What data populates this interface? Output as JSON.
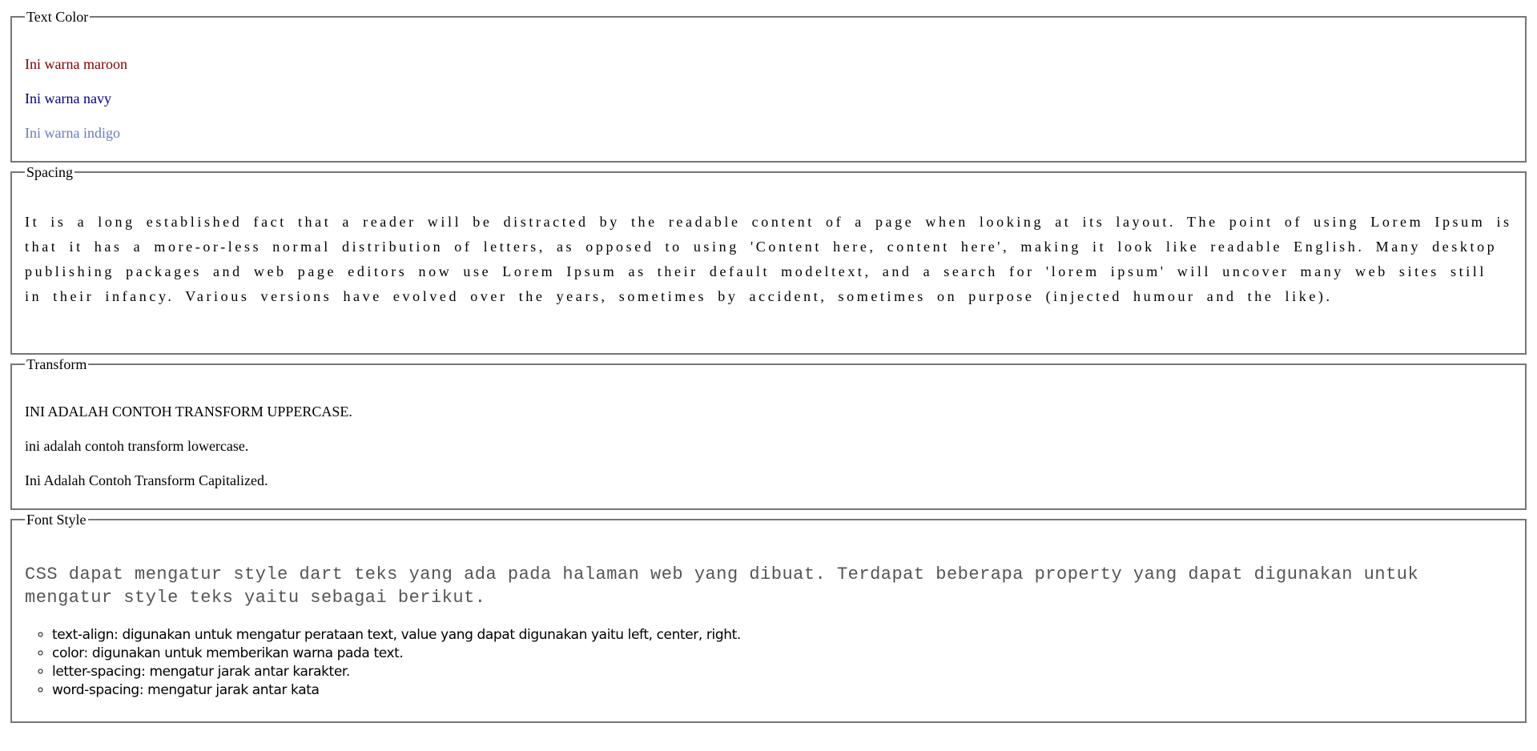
{
  "text_color": {
    "legend": "Text Color",
    "items": [
      {
        "text": "Ini warna maroon",
        "color": "#800000"
      },
      {
        "text": "Ini warna navy",
        "color": "#000080"
      },
      {
        "text": "Ini warna indigo",
        "color": "#6a7bbd"
      }
    ]
  },
  "spacing": {
    "legend": "Spacing",
    "paragraph": "It is a long established fact that a reader will be distracted by the readable content of a page when looking at its layout. The point of using Lorem Ipsum is that it has a more-or-less normal distribution of letters, as opposed to using 'Content here, content here', making it look like readable English. Many desktop publishing packages and web page editors now use Lorem Ipsum as their default modeltext, and a search for 'lorem ipsum' will uncover many web sites still in their infancy. Various versions have evolved over the years, sometimes by accident, sometimes on purpose (injected humour and the like)."
  },
  "transform": {
    "legend": "Transform",
    "uppercase": "INI ADALAH CONTOH TRANSFORM UPPERCASE.",
    "lowercase": "ini adalah contoh transform lowercase.",
    "capitalized": "Ini Adalah Contoh Transform Capitalized."
  },
  "font_style": {
    "legend": "Font Style",
    "paragraph": "CSS dapat mengatur style dart teks yang ada pada halaman web yang dibuat. Terdapat beberapa property yang dapat digunakan untuk mengatur style teks yaitu sebagai berikut.",
    "list": [
      "text-align: digunakan untuk mengatur perataan text, value yang dapat digunakan yaitu left, center, right.",
      "color: digunakan untuk memberikan warna pada text.",
      "letter-spacing: mengatur jarak antar karakter.",
      "word-spacing: mengatur jarak antar kata"
    ]
  }
}
